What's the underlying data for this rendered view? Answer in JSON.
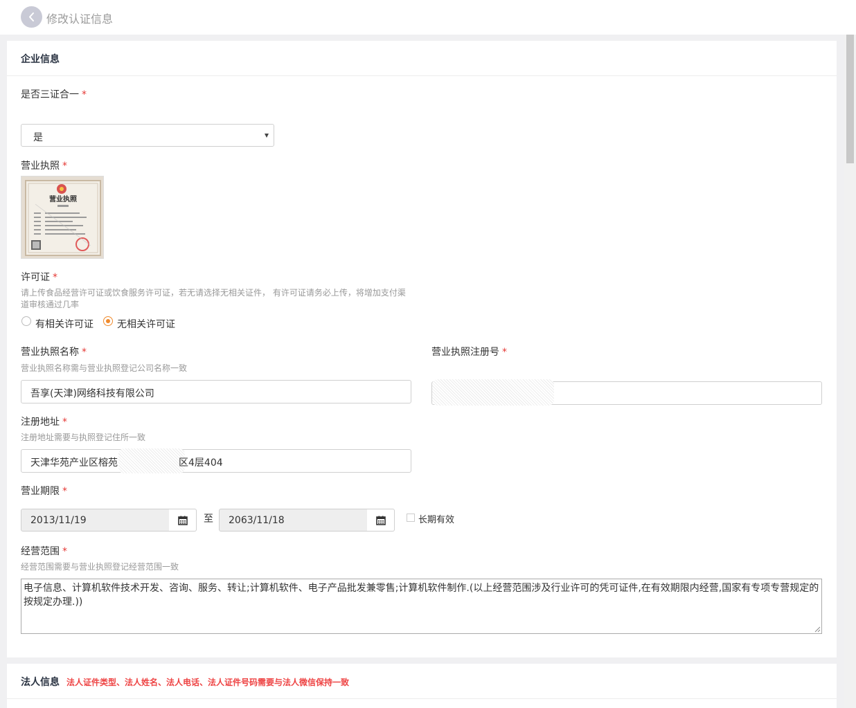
{
  "header": {
    "title": "修改认证信息"
  },
  "enterprise": {
    "title": "企业信息",
    "three_in_one": {
      "label": "是否三证合一",
      "value": "是"
    },
    "business_license": {
      "label": "营业执照",
      "image_title": "营业执照"
    },
    "permit": {
      "label": "许可证",
      "hint": "请上传食品经营许可证或饮食服务许可证，若无请选择无相关证件， 有许可证请务必上传，将增加支付渠道审核通过几率",
      "options": [
        "有相关许可证",
        "无相关许可证"
      ],
      "selected": "无相关许可证"
    },
    "license_name": {
      "label": "营业执照名称",
      "hint": "营业执照名称需与营业执照登记公司名称一致",
      "value": "吾享(天津)网络科技有限公司"
    },
    "reg_number": {
      "label": "营业执照注册号",
      "value": ""
    },
    "reg_address": {
      "label": "注册地址",
      "hint": "注册地址需要与执照登记住所一致",
      "value_start": "天津华苑产业区榕苑",
      "value_end": "区4层404"
    },
    "term": {
      "label": "营业期限",
      "start": "2013/11/19",
      "to": "至",
      "end": "2063/11/18",
      "long_term": "长期有效"
    },
    "scope": {
      "label": "经营范围",
      "hint": "经营范围需要与营业执照登记经营范围一致",
      "value": "电子信息、计算机软件技术开发、咨询、服务、转让;计算机软件、电子产品批发兼零售;计算机软件制作.(以上经营范围涉及行业许可的凭可证件,在有效期限内经营,国家有专项专营规定的按规定办理.))"
    }
  },
  "legal": {
    "title": "法人信息",
    "note": "法人证件类型、法人姓名、法人电话、法人证件号码需要与法人微信保持一致"
  },
  "required_mark": "*",
  "colors": {
    "accent": "#f08a2c",
    "required": "#e53935",
    "header_icon": "#c9cad6"
  }
}
